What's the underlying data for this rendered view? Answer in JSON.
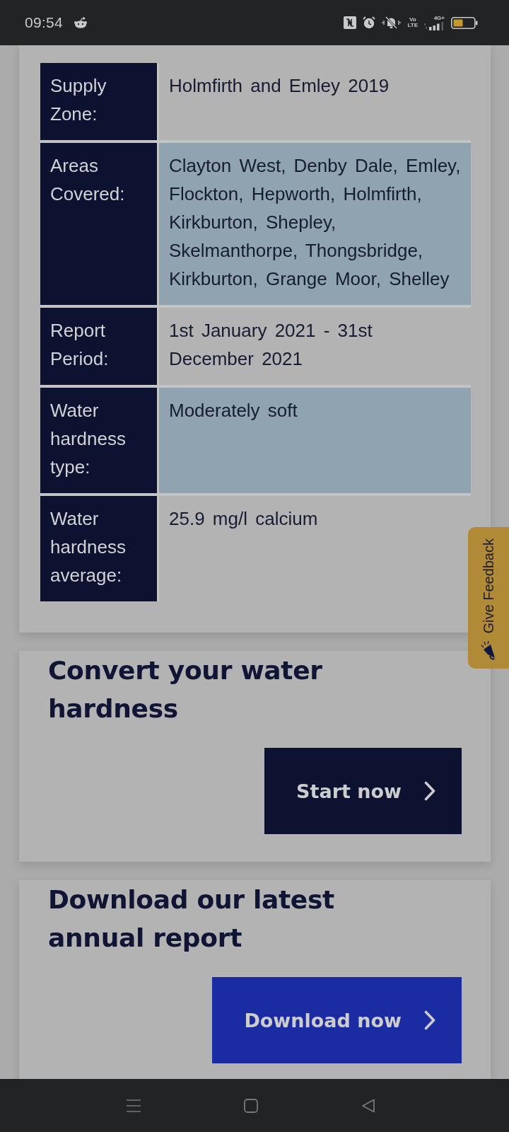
{
  "status_bar": {
    "time": "09:54",
    "volte": [
      "Vo",
      "LTE"
    ],
    "network": "4G+"
  },
  "info_table": {
    "rows": [
      {
        "label": "Supply Zone:",
        "value": "Holmfirth and Emley 2019"
      },
      {
        "label": "Areas Covered:",
        "value": "Clayton West, Denby Dale, Emley, Flockton, Hepworth, Holmfirth, Kirkburton, Shepley, Skelmanthorpe, Thongsbridge, Kirkburton, Grange Moor, Shelley"
      },
      {
        "label": "Report Period:",
        "value": "1st January 2021 - 31st December 2021"
      },
      {
        "label": "Water hardness type:",
        "value": "Moderately soft"
      },
      {
        "label": "Water hardness average:",
        "value": "25.9 mg/l calcium"
      }
    ]
  },
  "cards": [
    {
      "title": "Convert your water hardness",
      "button": {
        "label": "Start now",
        "kind": "dark"
      }
    },
    {
      "title": "Download our latest annual report",
      "button": {
        "label": "Download now",
        "kind": "bright"
      }
    }
  ],
  "feedback_tab": {
    "label": "Give Feedback"
  }
}
